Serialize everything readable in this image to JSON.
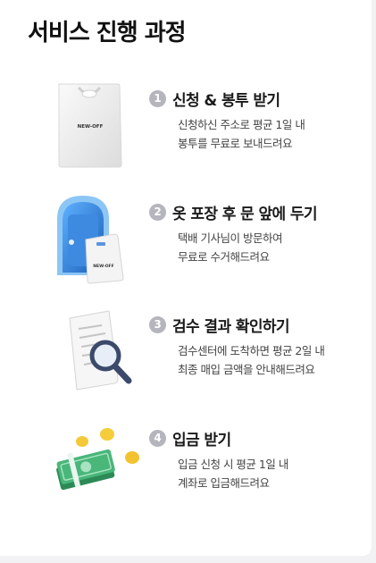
{
  "title": "서비스 진행 과정",
  "steps": [
    {
      "number": "1",
      "title": "신청 & 봉투 받기",
      "desc": [
        "신청하신 주소로 평균 1일 내",
        "봉투를 무료로 보내드려요"
      ],
      "bag_label": "NEW-OFF",
      "icon": "shopping-bag-icon"
    },
    {
      "number": "2",
      "title": "옷 포장 후 문 앞에 두기",
      "desc": [
        "택배 기사님이 방문하여",
        "무료로 수거해드려요"
      ],
      "bag_label": "NEW-OFF",
      "icon": "door-with-bag-icon"
    },
    {
      "number": "3",
      "title": "검수 결과 확인하기",
      "desc": [
        "검수센터에 도착하면 평균 2일 내",
        "최종 매입 금액을 안내해드려요"
      ],
      "icon": "document-magnifier-icon"
    },
    {
      "number": "4",
      "title": "입금 받기",
      "desc": [
        "입금 신청 시 평균 1일 내",
        "계좌로 입금해드려요"
      ],
      "icon": "money-coins-icon"
    }
  ],
  "colors": {
    "number_badge": "#b5b5bd",
    "door_blue": "#2f7fd8",
    "money_green": "#3aa36a",
    "coin_gold": "#f2c230"
  }
}
